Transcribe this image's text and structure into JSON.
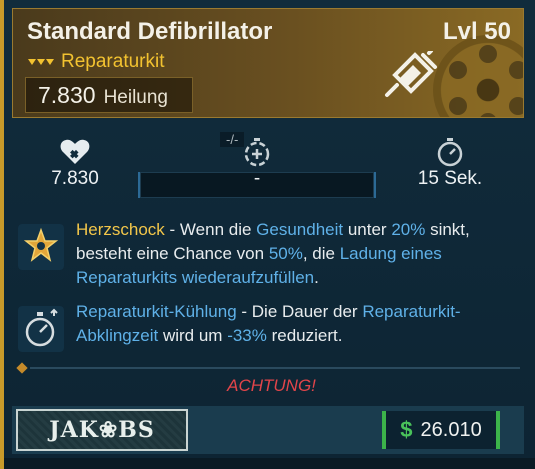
{
  "item": {
    "name": "Standard Defibrillator",
    "level": "Lvl 50",
    "rarity": "Reparaturkit",
    "heal_value": "7.830",
    "heal_label": "Heilung"
  },
  "stats": {
    "heal": "7.830",
    "tag": "-/-",
    "middle": "-",
    "cooldown": "15 Sek."
  },
  "perks": [
    {
      "name": "Herzschock",
      "parts": [
        " - Wenn die ",
        "Gesundheit",
        " unter ",
        "20%",
        " sinkt, besteht eine Chance von ",
        "50%",
        ", die ",
        "Ladung eines Reparaturkits wiederaufzufüllen",
        "."
      ]
    },
    {
      "name": "Reparaturkit-Kühlung",
      "parts": [
        " - Die Dauer der ",
        "Reparaturkit-Abklingzeit",
        " wird um ",
        "-33%",
        " reduziert."
      ]
    }
  ],
  "warning": "ACHTUNG!",
  "seller": "JAK❀BS",
  "price": {
    "symbol": "$",
    "value": "26.010"
  },
  "colors": {
    "accent_gold": "#f2c230",
    "highlight_blue": "#5fb1e8",
    "warning_red": "#e2454a",
    "price_green": "#49c25a"
  },
  "icons": [
    "syringe-icon",
    "heart-icon",
    "timer-icon",
    "star-badge-icon",
    "cooldown-icon",
    "rarity-chevrons-icon"
  ]
}
